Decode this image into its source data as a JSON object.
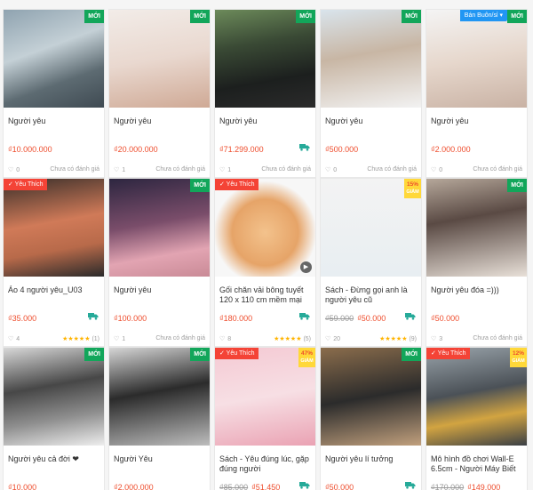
{
  "labels": {
    "new": "MỚI",
    "favorite": "Yêu Thích",
    "wholesale": "Bán Buôn/sỉ",
    "not_rated": "Chưa có đánh giá",
    "stars": "★★★★★"
  },
  "colors": {
    "price": "#ee4d2d",
    "new_badge": "#12a65a",
    "favorite_tag": "#f44336",
    "wholesale_tag": "#2196f3",
    "discount_badge": "#ffd839",
    "ship_icon": "#26aa99"
  },
  "products": [
    {
      "name": "Người yêu",
      "price": "₫10.000.000",
      "old_price": "",
      "likes": "0",
      "rating_count": "",
      "tag": "",
      "new": true,
      "discount": "",
      "ship": false,
      "video": false
    },
    {
      "name": "Người yêu",
      "price": "₫20.000.000",
      "old_price": "",
      "likes": "1",
      "rating_count": "",
      "tag": "",
      "new": true,
      "discount": "",
      "ship": false,
      "video": false
    },
    {
      "name": "Người yêu",
      "price": "₫71.299.000",
      "old_price": "",
      "likes": "1",
      "rating_count": "",
      "tag": "",
      "new": true,
      "discount": "",
      "ship": true,
      "video": false
    },
    {
      "name": "Người yêu",
      "price": "₫500.000",
      "old_price": "",
      "likes": "0",
      "rating_count": "",
      "tag": "",
      "new": true,
      "discount": "",
      "ship": false,
      "video": false
    },
    {
      "name": "Người yêu",
      "price": "₫2.000.000",
      "old_price": "",
      "likes": "0",
      "rating_count": "",
      "tag": "wholesale",
      "new": true,
      "discount": "",
      "ship": false,
      "video": false
    },
    {
      "name": "Áo 4 người yêu_U03",
      "price": "₫35.000",
      "old_price": "",
      "likes": "4",
      "rating_count": "(1)",
      "tag": "favorite",
      "new": false,
      "discount": "",
      "ship": true,
      "video": false
    },
    {
      "name": "Người yêu",
      "price": "₫100.000",
      "old_price": "",
      "likes": "1",
      "rating_count": "",
      "tag": "",
      "new": true,
      "discount": "",
      "ship": false,
      "video": false
    },
    {
      "name": "Gối chăn vải bông tuyết 120 x 110 cm mềm mại",
      "price": "₫180.000",
      "old_price": "",
      "likes": "8",
      "rating_count": "(5)",
      "tag": "favorite",
      "new": false,
      "discount": "",
      "ship": true,
      "video": true
    },
    {
      "name": "Sách - Đừng gọi anh là người yêu cũ",
      "price": "₫50.000",
      "old_price": "₫59.000",
      "likes": "20",
      "rating_count": "(9)",
      "tag": "",
      "new": false,
      "discount": "15% GIẢM",
      "ship": true,
      "video": false
    },
    {
      "name": "Người yêu đóa =)))",
      "price": "₫50.000",
      "old_price": "",
      "likes": "3",
      "rating_count": "",
      "tag": "",
      "new": true,
      "discount": "",
      "ship": false,
      "video": false
    },
    {
      "name": "Người yêu cả đời ❤",
      "price": "₫10.000",
      "old_price": "",
      "likes": "",
      "rating_count": "",
      "tag": "",
      "new": true,
      "discount": "",
      "ship": false,
      "video": false
    },
    {
      "name": "Người Yêu",
      "price": "₫2.000.000",
      "old_price": "",
      "likes": "",
      "rating_count": "",
      "tag": "",
      "new": true,
      "discount": "",
      "ship": false,
      "video": false
    },
    {
      "name": "Sách - Yêu đúng lúc, gặp đúng người",
      "price": "₫51.450",
      "old_price": "₫85.000",
      "likes": "",
      "rating_count": "",
      "tag": "favorite",
      "new": false,
      "discount": "47% GIẢM",
      "ship": true,
      "video": false
    },
    {
      "name": "Người yêu lí tưởng",
      "price": "₫50.000",
      "old_price": "",
      "likes": "",
      "rating_count": "",
      "tag": "",
      "new": true,
      "discount": "",
      "ship": true,
      "video": false
    },
    {
      "name": "Mô hình đồ chơi Wall-E 6.5cm - Người Máy Biết",
      "price": "₫149.000",
      "old_price": "₫170.000",
      "likes": "",
      "rating_count": "",
      "tag": "favorite",
      "new": false,
      "discount": "12% GIẢM",
      "ship": false,
      "video": false
    }
  ]
}
